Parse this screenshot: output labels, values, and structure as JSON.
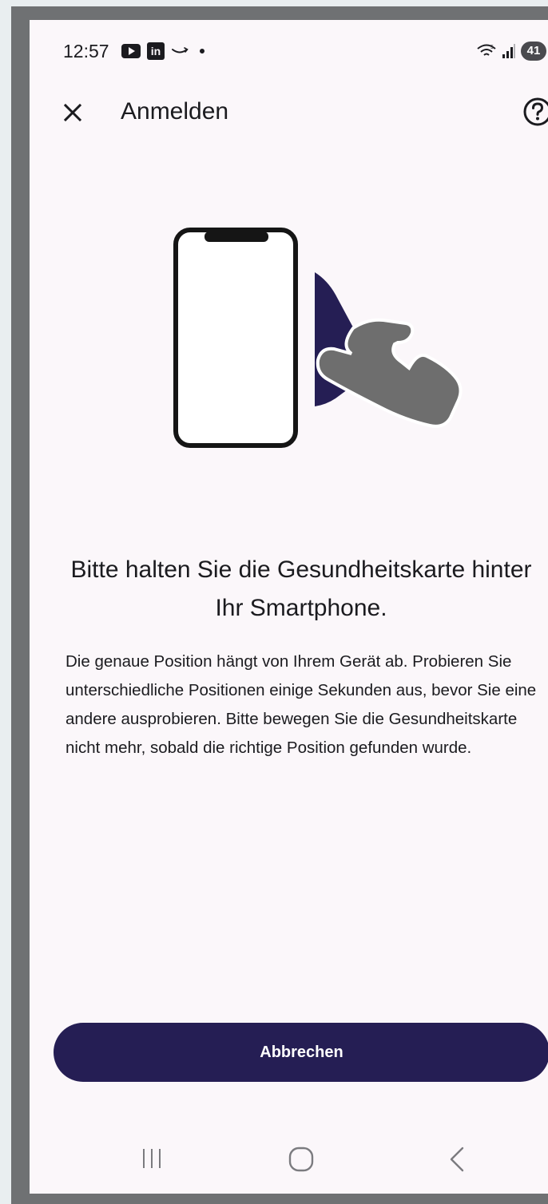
{
  "status_bar": {
    "time": "12:57",
    "battery_level": "41",
    "left_icons": [
      "youtube-icon",
      "linkedin-icon",
      "amazon-icon",
      "notification-dot-icon"
    ],
    "right_icons": [
      "wifi-icon",
      "signal-icon",
      "battery-icon"
    ]
  },
  "app_bar": {
    "title": "Anmelden",
    "close_icon": "close-icon",
    "help_icon": "help-circle-icon"
  },
  "illustration": {
    "icon": "phone-card-hand-illustration",
    "card_color": "#251e54",
    "hand_color": "#6e6e6e"
  },
  "content": {
    "heading": "Bitte halten Sie die Gesundheitskarte hinter Ihr Smartphone.",
    "body": "Die genaue Position hängt von Ihrem Gerät ab. Probieren Sie unterschiedliche Positionen einige Sekunden aus, bevor Sie eine andere ausprobieren. Bitte bewegen Sie die Gesundheitskarte nicht mehr, sobald die richtige Position gefunden wurde."
  },
  "actions": {
    "cancel_label": "Abbrechen"
  },
  "nav_bar": {
    "icons": [
      "recents-icon",
      "home-icon",
      "back-icon"
    ]
  },
  "colors": {
    "accent": "#251e54",
    "background": "#fbf7fa",
    "text": "#1b1b1f"
  }
}
